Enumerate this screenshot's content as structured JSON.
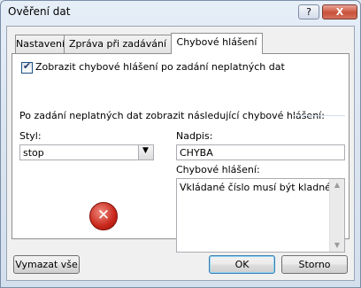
{
  "window": {
    "title": "Ověření dat",
    "help_label": "?",
    "close_label": "X"
  },
  "tabs": [
    {
      "label": "Nastavení"
    },
    {
      "label": "Zpráva při zadávání"
    },
    {
      "label": "Chybové hlášení",
      "active": true
    }
  ],
  "error_tab": {
    "show_checkbox": {
      "label": "Zobrazit chybové hlášení po zadání neplatných dat",
      "checked": true
    },
    "group_label": "Po zadání neplatných dat zobrazit následující chybové hlášení:",
    "style": {
      "label": "Styl:",
      "value": "stop"
    },
    "title": {
      "label": "Nadpis:",
      "value": "CHYBA"
    },
    "message": {
      "label": "Chybové hlášení:",
      "value": "Vkládané číslo musí být kladné !!"
    },
    "icon": "error-icon"
  },
  "buttons": {
    "clear_all": "Vymazat vše",
    "ok": "OK",
    "cancel": "Storno"
  }
}
